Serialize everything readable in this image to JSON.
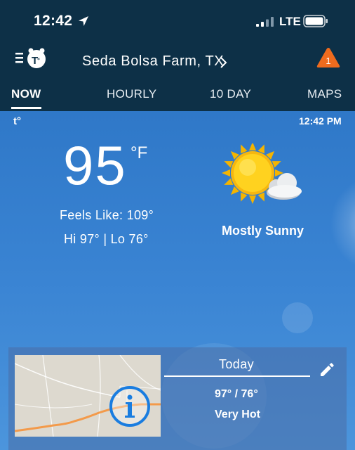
{
  "status_bar": {
    "time": "12:42",
    "network": "LTE",
    "icons": [
      "location-arrow-icon",
      "signal-icon",
      "battery-icon"
    ]
  },
  "header": {
    "location": "Seda Bolsa Farm, TX",
    "alert_count": "1",
    "alert_color": "#ee6b1e",
    "icons": [
      "menu-icon",
      "app-logo-icon",
      "chevron-right-icon",
      "alert-triangle-icon"
    ]
  },
  "tabs": [
    {
      "label": "NOW",
      "active": true
    },
    {
      "label": "HOURLY",
      "active": false
    },
    {
      "label": "10 DAY",
      "active": false
    },
    {
      "label": "MAPS",
      "active": false
    }
  ],
  "current": {
    "brand_mark": "t°",
    "updated_time": "12:42 PM",
    "temperature": "95",
    "unit": "°F",
    "feels_like": "Feels Like: 109°",
    "hi_lo": "Hi 97° | Lo 76°",
    "condition": "Mostly Sunny",
    "condition_icon": "sun-cloud-icon"
  },
  "forecast_card": {
    "day": "Today",
    "hi_lo": "97° / 76°",
    "description": "Very Hot",
    "icons": [
      "map-thumbnail",
      "info-icon",
      "pencil-icon"
    ]
  },
  "colors": {
    "header_bg": "#0d3047",
    "sky_top": "#2f78c8",
    "sky_bottom": "#4c95dc",
    "info_blue": "#1a7de0",
    "road_orange": "#f39a4a"
  }
}
